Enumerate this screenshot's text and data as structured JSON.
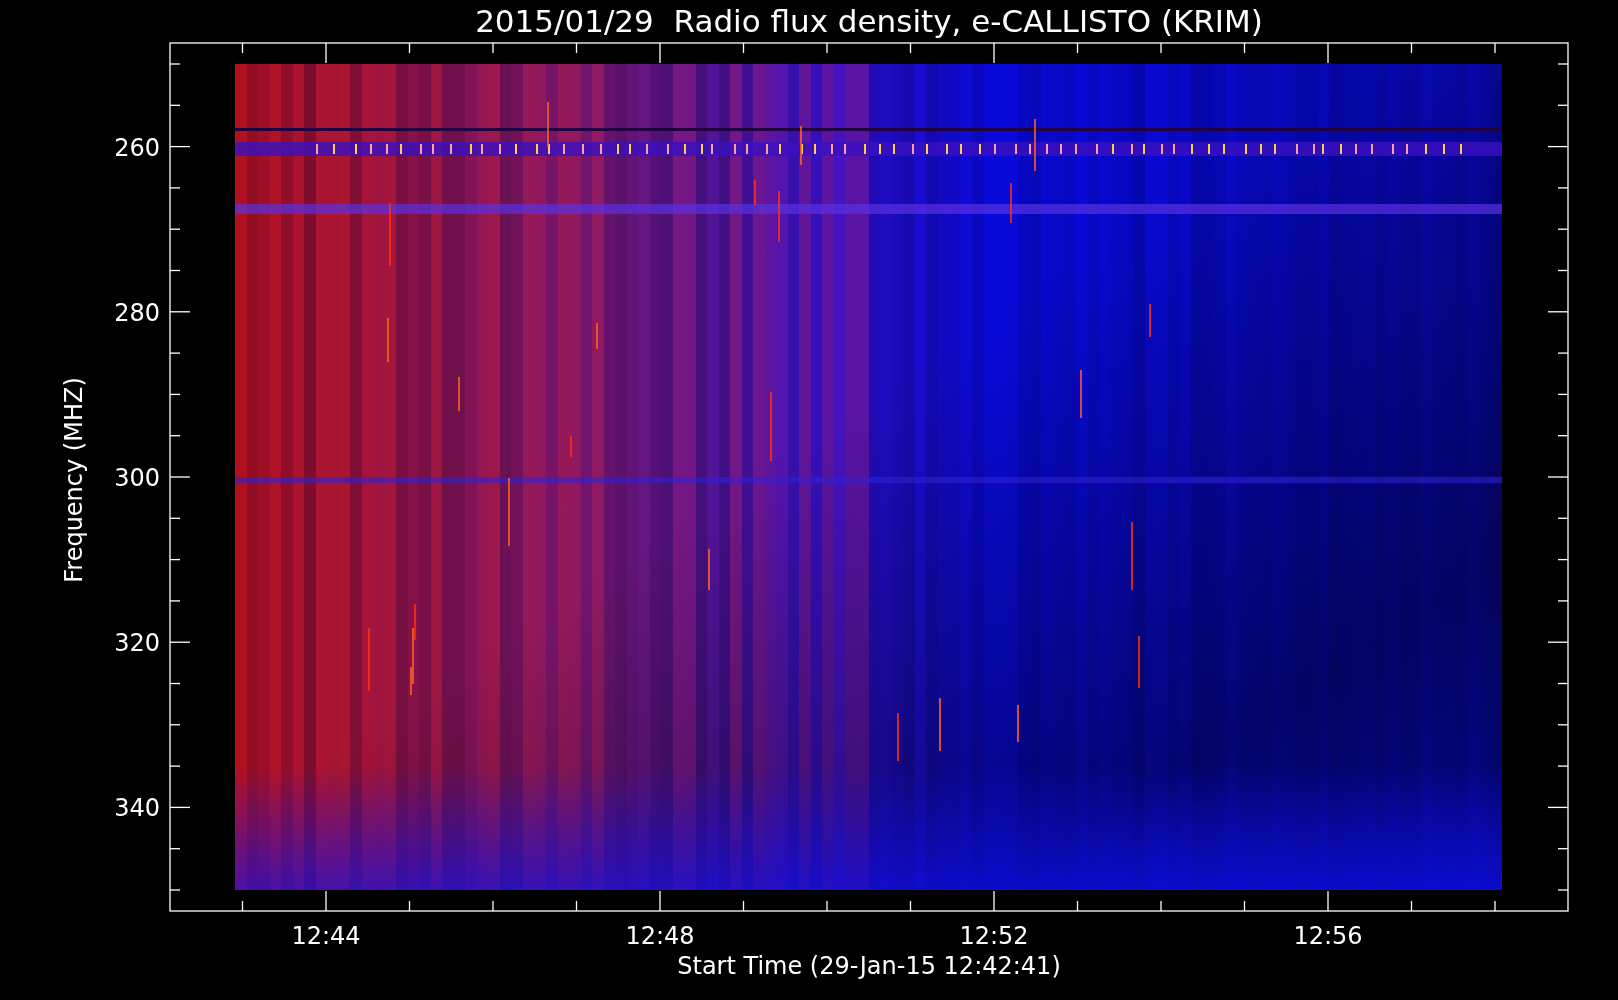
{
  "title": "2015/01/29  Radio flux density, e-CALLISTO (KRIM)",
  "y_axis": {
    "title": "Frequency (MHZ)",
    "ticks": [
      "260",
      "280",
      "300",
      "320",
      "340"
    ]
  },
  "x_axis": {
    "title": "Start Time (29-Jan-15 12:42:41)",
    "ticks": [
      "12:44",
      "12:48",
      "12:52",
      "12:56"
    ]
  }
}
